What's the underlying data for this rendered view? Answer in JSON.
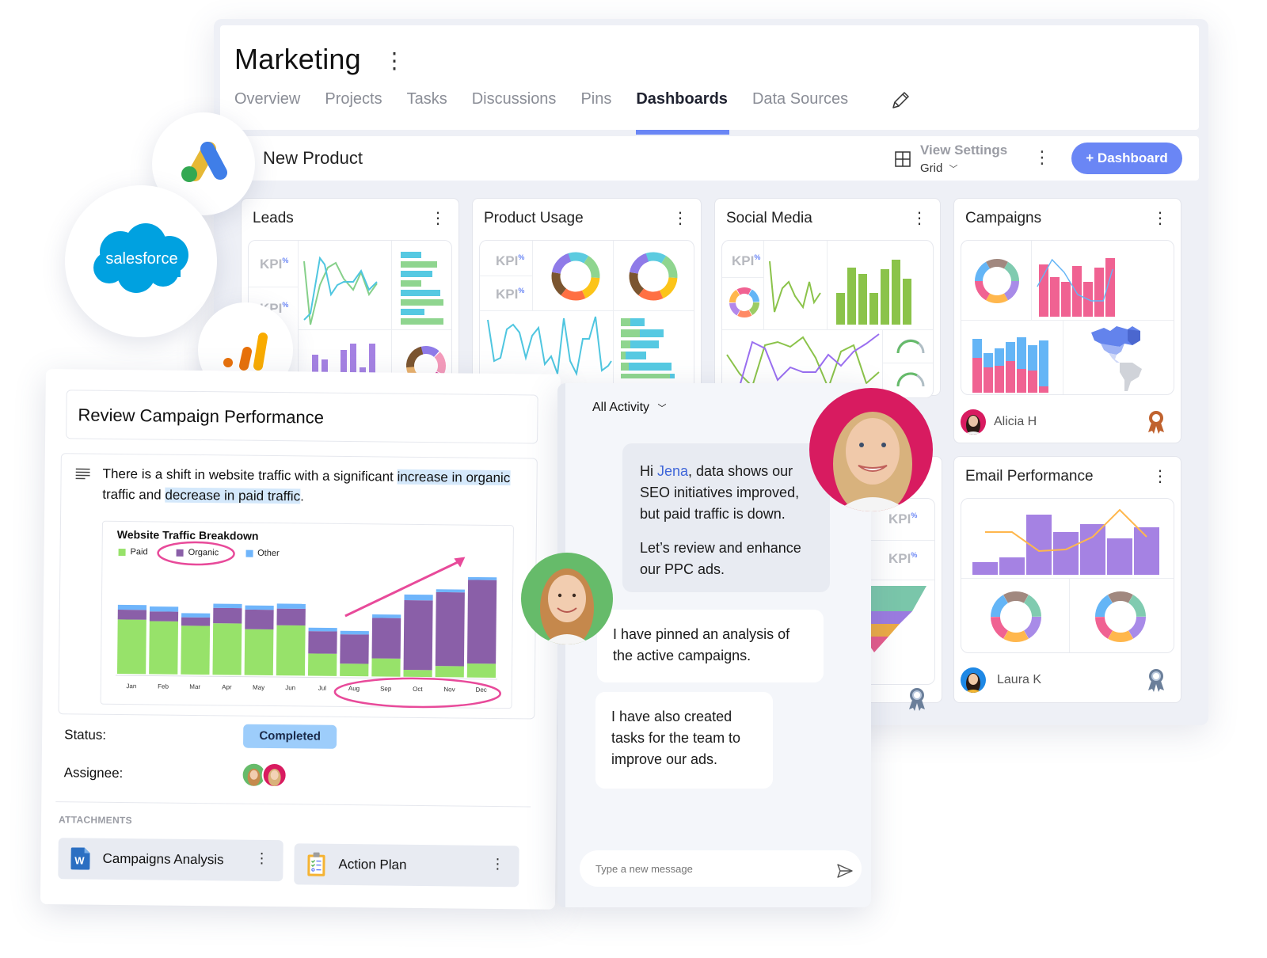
{
  "app": {
    "title": "Marketing",
    "tabs": [
      {
        "label": "Overview",
        "active": false
      },
      {
        "label": "Projects",
        "active": false
      },
      {
        "label": "Tasks",
        "active": false
      },
      {
        "label": "Discussions",
        "active": false
      },
      {
        "label": "Pins",
        "active": false
      },
      {
        "label": "Dashboards",
        "active": true
      },
      {
        "label": "Data Sources",
        "active": false
      }
    ],
    "accent_color": "#6a86f5"
  },
  "dashboard": {
    "name": "New Product",
    "view_settings_label": "View Settings",
    "view_mode": "Grid",
    "add_button_label": "+ Dashboard",
    "cards": [
      {
        "title": "Leads",
        "kpi_labels": [
          "KPI",
          "KPI"
        ]
      },
      {
        "title": "Product Usage",
        "kpi_labels": [
          "KPI",
          "KPI"
        ]
      },
      {
        "title": "Social Media",
        "kpi_labels": [
          "KPI"
        ]
      },
      {
        "title": "Campaigns",
        "owner": "Alicia H",
        "badge": "award-bronze"
      },
      {
        "title": "Email Performance",
        "owner": "Laura K",
        "badge": "award-silver"
      },
      {
        "title": "",
        "kpi_labels": [
          "KPI",
          "KPI"
        ],
        "badge": "award-silver"
      }
    ],
    "kpi_suffix": "%"
  },
  "integrations": [
    {
      "name": "Google Ads"
    },
    {
      "name": "salesforce"
    },
    {
      "name": "Google Analytics"
    }
  ],
  "task": {
    "title": "Review Campaign Performance",
    "description": {
      "part1": "There is a shift in website traffic with a significant ",
      "highlight1": "increase in organic",
      "part2": " traffic and ",
      "highlight2": "decrease in paid traffic",
      "part3": "."
    },
    "status_label": "Status:",
    "status_value": "Completed",
    "assignee_label": "Assignee:",
    "attachments_label": "ATTACHMENTS",
    "attachments": [
      {
        "name": "Campaigns Analysis",
        "type": "word-doc"
      },
      {
        "name": "Action Plan",
        "type": "checklist"
      }
    ]
  },
  "chart_data": {
    "type": "bar",
    "stacked": true,
    "title": "Website Traffic Breakdown",
    "categories": [
      "Jan",
      "Feb",
      "Mar",
      "Apr",
      "May",
      "Jun",
      "Jul",
      "Aug",
      "Sep",
      "Oct",
      "Nov",
      "Dec"
    ],
    "series": [
      {
        "name": "Paid",
        "color": "#97e26a",
        "values": [
          78,
          76,
          70,
          74,
          66,
          72,
          32,
          18,
          26,
          10,
          16,
          20
        ]
      },
      {
        "name": "Organic",
        "color": "#8a5fa8",
        "values": [
          14,
          14,
          12,
          22,
          28,
          24,
          32,
          42,
          58,
          100,
          106,
          120
        ]
      },
      {
        "name": "Other",
        "color": "#6fb5fb",
        "values": [
          7,
          7,
          6,
          6,
          6,
          7,
          5,
          5,
          5,
          8,
          4,
          4
        ]
      }
    ],
    "xlabel": "",
    "ylabel": "",
    "ylim": [
      0,
      150
    ],
    "grid": false,
    "legend": "top-left",
    "annotations": [
      "circle around Organic legend",
      "arrow showing upward trend Aug–Dec",
      "circle around Aug–Dec labels"
    ]
  },
  "activity": {
    "filter_label": "All Activity",
    "messages": [
      {
        "mention": "Jena",
        "pre": "Hi ",
        "post": ", data shows our SEO initiatives improved, but paid traffic is down.",
        "para2": "Let’s review and enhance our PPC ads."
      },
      {
        "text": "I have pinned an analysis of the active campaigns."
      },
      {
        "text": "I have also created tasks for the team to improve our ads."
      }
    ],
    "input_placeholder": "Type a new message"
  }
}
